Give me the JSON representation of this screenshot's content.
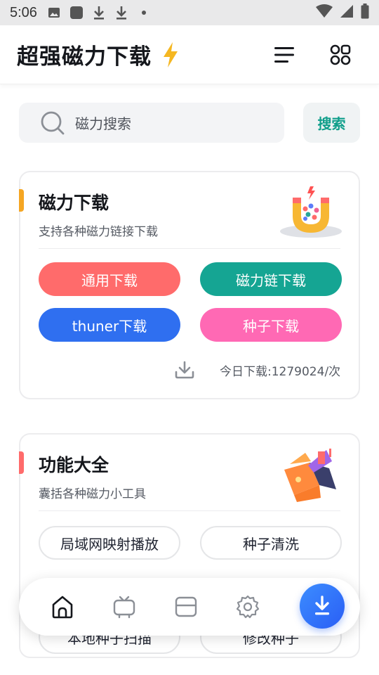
{
  "status_bar": {
    "time": "5:06",
    "icons": [
      "image-icon",
      "square-icon",
      "download-icon",
      "download-icon",
      "dot-icon",
      "wifi-icon",
      "signal-icon",
      "battery-icon"
    ]
  },
  "app_bar": {
    "title": "超强磁力下载",
    "icons": [
      "bolt-icon",
      "menu-icon",
      "grid-icon"
    ]
  },
  "search": {
    "placeholder": "磁力搜索",
    "button_label": "搜索"
  },
  "download_card": {
    "title": "磁力下载",
    "subtitle": "支持各种磁力链接下载",
    "accent_color": "#f5a623",
    "buttons": [
      {
        "label": "通用下载",
        "color": "#ff6b6b"
      },
      {
        "label": "磁力链下载",
        "color": "#15a593"
      },
      {
        "label": "thuner下载",
        "color": "#2f6ff0"
      },
      {
        "label": "种子下载",
        "color": "#ff69b4"
      }
    ],
    "stat_text": "今日下载:1279024/次"
  },
  "tools_card": {
    "title": "功能大全",
    "subtitle": "囊括各种磁力小工具",
    "accent_color": "#ff6b6b",
    "buttons": [
      {
        "label": "局域网映射播放"
      },
      {
        "label": "种子清洗"
      },
      {
        "label": "本地种子扫描"
      },
      {
        "label": "修改种子"
      }
    ]
  },
  "bottom_nav": {
    "items": [
      "home-icon",
      "tv-icon",
      "cards-icon",
      "settings-icon"
    ],
    "fab_icon": "download-icon",
    "accent": "#2f6ff0"
  }
}
